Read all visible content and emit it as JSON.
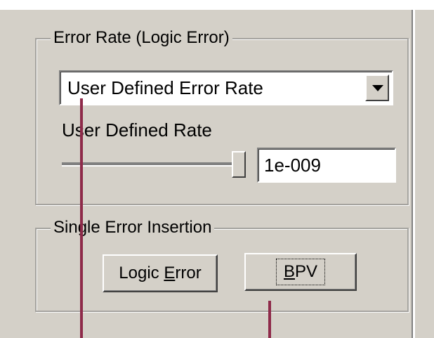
{
  "error_rate_group": {
    "title": "Error Rate (Logic Error)",
    "mode_select": {
      "value": "User Defined Error Rate"
    },
    "user_rate_label": "User Defined Rate",
    "rate_input": {
      "value": "1e-009"
    }
  },
  "single_error_group": {
    "title": "Single Error Insertion",
    "logic_error_button": {
      "prefix": "Logic ",
      "mnemonic": "E",
      "suffix": "rror"
    },
    "bpv_button": {
      "prefix": "",
      "mnemonic": "B",
      "suffix": "PV"
    }
  },
  "colors": {
    "panel_bg": "#d4d0c8",
    "marker": "#8e2a4a"
  },
  "icons": {
    "dropdown": "chevron-down-icon"
  }
}
